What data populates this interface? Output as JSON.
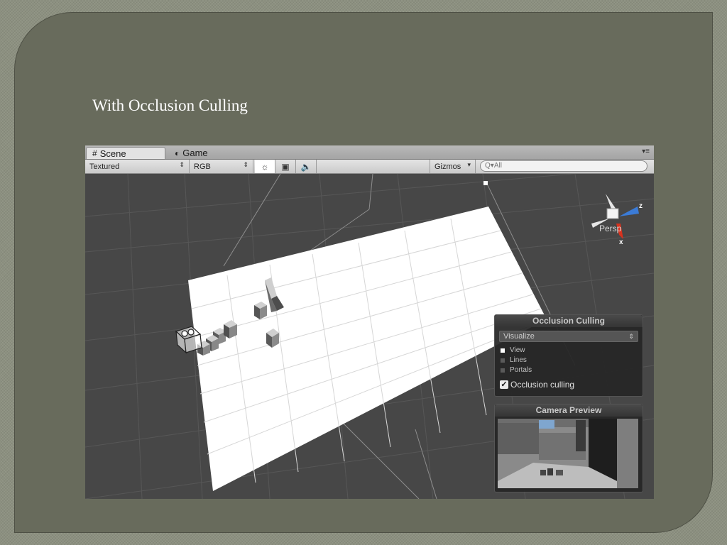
{
  "slide": {
    "title": "With Occlusion Culling"
  },
  "editor": {
    "tabs": [
      {
        "label": "Scene",
        "icon": "grid-icon",
        "active": true
      },
      {
        "label": "Game",
        "icon": "pacman-icon",
        "active": false
      }
    ],
    "toolbar": {
      "render_mode": "Textured",
      "color_mode": "RGB",
      "buttons": [
        {
          "name": "scene-lighting-toggle",
          "icon": "sun-icon",
          "active": true
        },
        {
          "name": "scene-overlay-toggle",
          "icon": "image-icon",
          "active": false
        },
        {
          "name": "scene-audio-toggle",
          "icon": "speaker-icon",
          "active": false
        }
      ],
      "gizmos_label": "Gizmos",
      "search_placeholder": "All"
    },
    "gizmo": {
      "persp_label": "Persp",
      "axis_z": "z",
      "axis_x": "x",
      "colors": {
        "z": "#3b7bd6",
        "x": "#d8321e",
        "y": "#e6e6e6"
      }
    },
    "occlusion_panel": {
      "title": "Occlusion Culling",
      "dropdown_value": "Visualize",
      "options": [
        {
          "label": "View",
          "enabled": true
        },
        {
          "label": "Lines",
          "enabled": false
        },
        {
          "label": "Portals",
          "enabled": false
        }
      ],
      "toggle_label": "Occlusion culling",
      "toggle_checked": true
    },
    "camera_panel": {
      "title": "Camera Preview"
    }
  }
}
